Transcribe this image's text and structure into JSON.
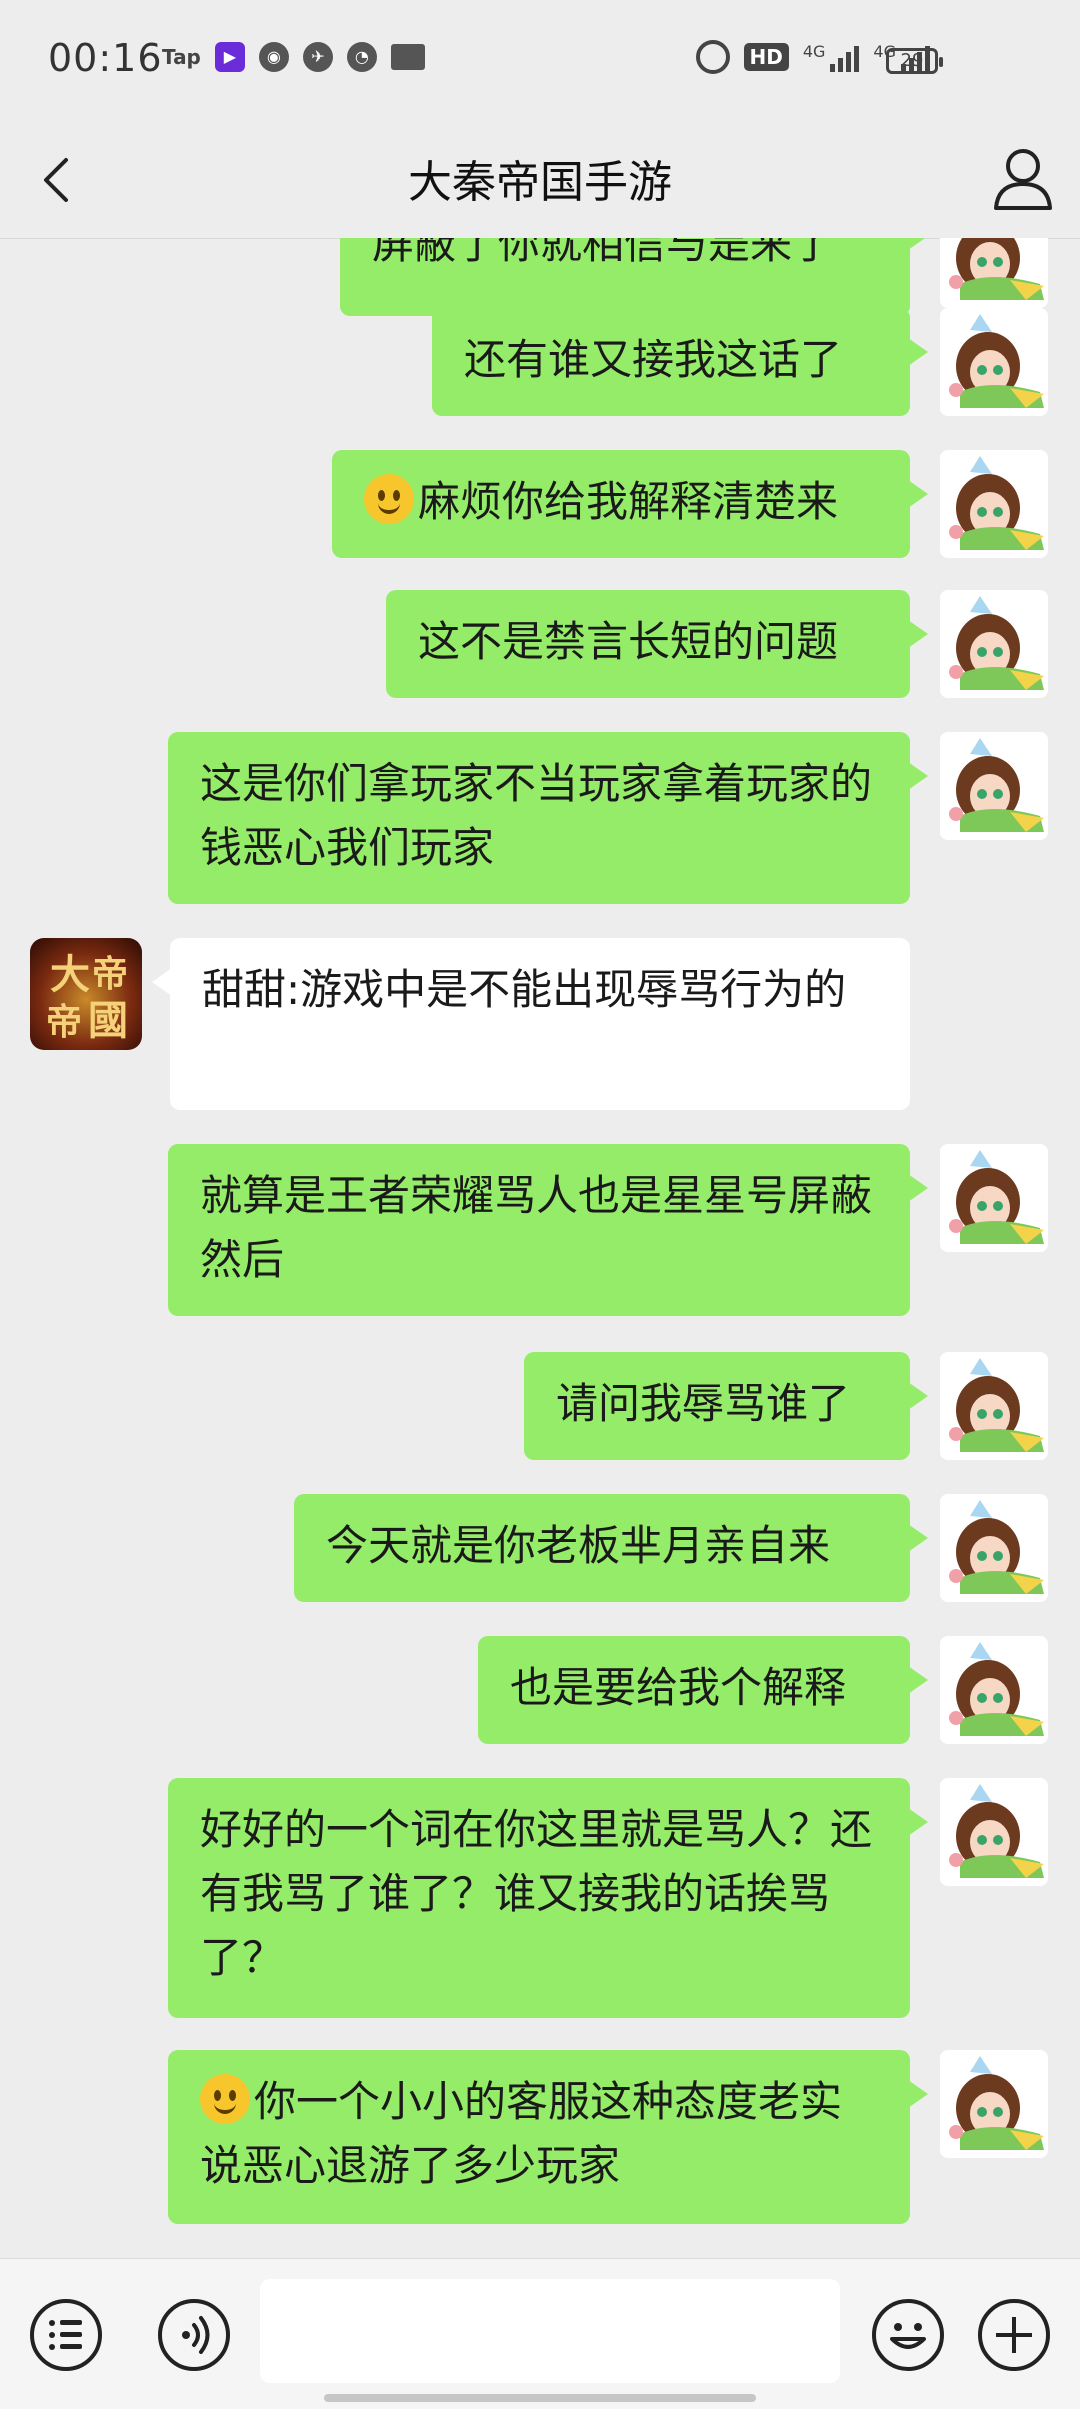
{
  "status_bar": {
    "time": "00:16",
    "tap_label": "Tap",
    "hd_label": "HD",
    "network_1": "4G",
    "network_2": "4G",
    "battery": "29"
  },
  "header": {
    "title": "大秦帝国手游"
  },
  "messages": [
    {
      "side": "right",
      "text": "屏蔽了你就相信与是来了",
      "partial": true
    },
    {
      "side": "right",
      "text": "还有谁又接我这话了"
    },
    {
      "side": "right",
      "emoji": true,
      "text": "麻烦你给我解释清楚来"
    },
    {
      "side": "right",
      "text": "这不是禁言长短的问题"
    },
    {
      "side": "right",
      "text": "这是你们拿玩家不当玩家拿着玩家的钱恶心我们玩家"
    },
    {
      "side": "left",
      "text": "甜甜:游戏中是不能出现辱骂行为的"
    },
    {
      "side": "right",
      "text": "就算是王者荣耀骂人也是星星号屏蔽然后"
    },
    {
      "side": "right",
      "text": "请问我辱骂谁了"
    },
    {
      "side": "right",
      "text": "今天就是你老板芈月亲自来"
    },
    {
      "side": "right",
      "text": "也是要给我个解释"
    },
    {
      "side": "right",
      "text": "好好的一个词在你这里就是骂人？还有我骂了谁了？谁又接我的话挨骂了？"
    },
    {
      "side": "right",
      "emoji": true,
      "text": "你一个小小的客服这种态度老实说恶心退游了多少玩家"
    }
  ],
  "game_avatar_text": [
    "大",
    "帝",
    "帝",
    "國"
  ],
  "input": {
    "placeholder": ""
  },
  "colors": {
    "my_bubble": "#95ec69",
    "their_bubble": "#ffffff",
    "background": "#ededed"
  }
}
